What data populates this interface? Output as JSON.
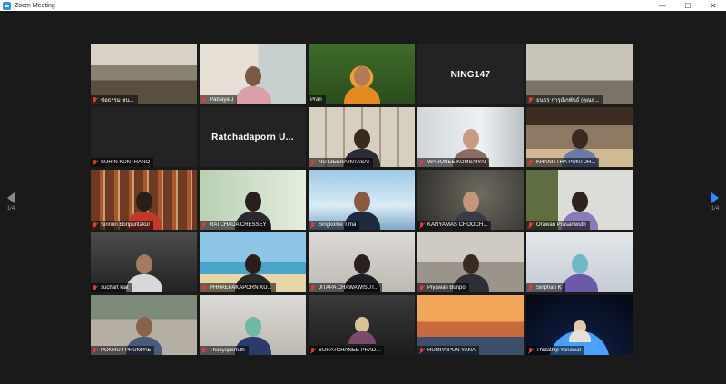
{
  "window": {
    "title": "Zoom Meeting",
    "minimize_glyph": "—",
    "maximize_glyph": "☐",
    "close_glyph": "✕"
  },
  "navigation": {
    "left_page": "1/4",
    "right_page": "1/4"
  },
  "participants": [
    {
      "name": "ช่อธรรม ชน..."
    },
    {
      "name": "Patsaya J"
    },
    {
      "name": "Pran"
    },
    {
      "name": "NING147"
    },
    {
      "name": "ธนธร การุณิกพันธ์ (คุณธ..."
    },
    {
      "name": "SURIN KUNTHANO"
    },
    {
      "name": "Ratchadaporn  U..."
    },
    {
      "name": "NUTJEERA INTASAI"
    },
    {
      "name": "WARUNEE KUMSAIYAI"
    },
    {
      "name": "KHANITTHA PUNTUR..."
    },
    {
      "name": "Sirinun Boripuntakul"
    },
    {
      "name": "RATCHADA CRESSEY"
    },
    {
      "name": "Singkome Tima"
    },
    {
      "name": "KANYAMAS CHOOCH..."
    },
    {
      "name": "Orawan Prasartwuth"
    },
    {
      "name": "suchart kiat"
    },
    {
      "name": "PHRAEPAKAPORN KU..."
    },
    {
      "name": "JITAPA CHAWAWISUT..."
    },
    {
      "name": "Piyawan Bunpo"
    },
    {
      "name": "Siriphan K"
    },
    {
      "name": "PONRUT PHUNPAE"
    },
    {
      "name": "Thanyaporn.th"
    },
    {
      "name": "SURATCHANEE PHAD..."
    },
    {
      "name": "RUMPAIPUN YANA"
    },
    {
      "name": "Thidathip Yanawat"
    }
  ],
  "colors": {
    "active_speaker_border": "#b9e23a",
    "muted_icon": "#e23b3b",
    "next_page_arrow": "#2d8cff"
  }
}
